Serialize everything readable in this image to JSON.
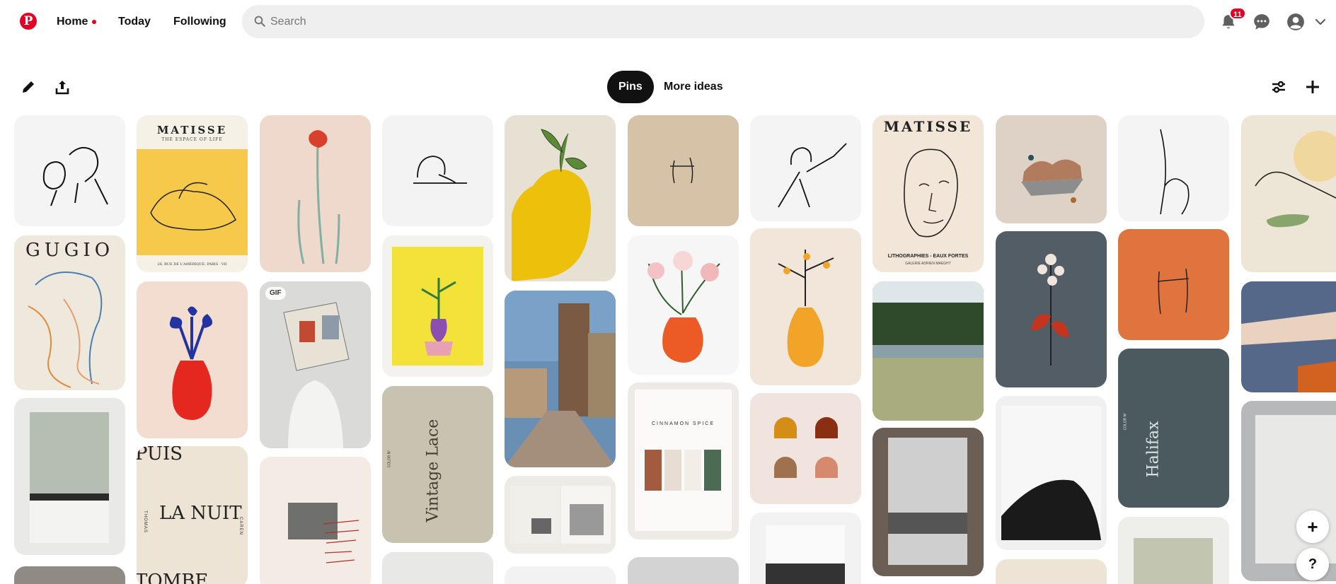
{
  "nav": {
    "logo_glyph": "P",
    "home_label": "Home",
    "today_label": "Today",
    "following_label": "Following",
    "notification_count": "11",
    "accent": "#e60023"
  },
  "search": {
    "placeholder": "Search",
    "value": ""
  },
  "toolbar": {
    "tabs": [
      {
        "label": "Pins",
        "active": true
      },
      {
        "label": "More ideas",
        "active": false
      }
    ]
  },
  "pins": [
    {
      "gif": false
    },
    {
      "text": "GUGIO"
    },
    {
      "text": "MATISSE",
      "subtext": "THE ESPACE OF LIFE",
      "footer": "26, RUE DE L'AMÉRIQUE, PARIS · VII"
    },
    {
      "text": "PUIS",
      "text2": "LA NUIT",
      "text3": "TOMBE",
      "side_left": "THOMAS",
      "side_right": "CAREN"
    },
    {
      "gif_label": "GIF"
    },
    {
      "title": "Vintage Lace",
      "color_label": "COLOR N°"
    },
    {
      "title": "CINNAMON SPICE"
    },
    {
      "text": "MATISSE",
      "footer": "LITHOGRAPHIES - EAUX FORTES",
      "footer2": "GALERIE ADRIEN MAEGHT"
    },
    {
      "title": "Halifax",
      "color_label": "COLOR N°"
    }
  ],
  "float_buttons": {
    "add_glyph": "+",
    "help_glyph": "?"
  }
}
